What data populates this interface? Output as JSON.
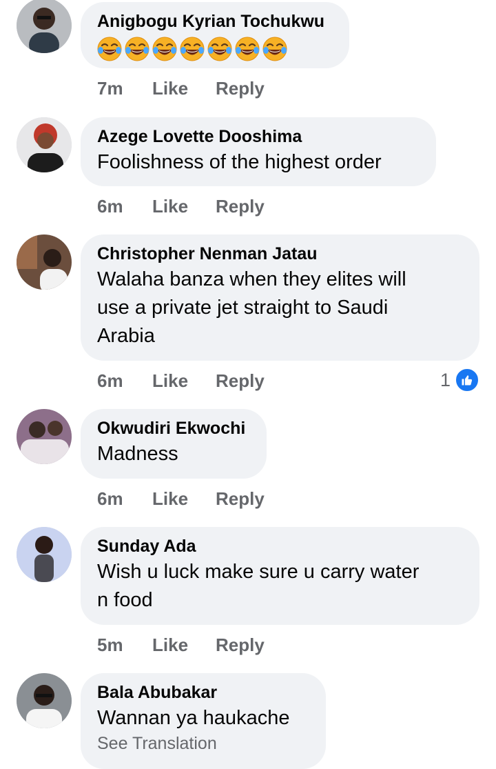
{
  "comments": [
    {
      "name": "Anigbogu Kyrian Tochukwu",
      "emoji": "😂😂😂😂😂😂😂",
      "emoji_count": 7,
      "time": "7m",
      "like": "Like",
      "reply": "Reply"
    },
    {
      "name": "Azege Lovette Dooshima",
      "text": "Foolishness of the highest order",
      "time": "6m",
      "like": "Like",
      "reply": "Reply"
    },
    {
      "name": "Christopher Nenman Jatau",
      "text_lines": [
        "Walaha banza when they elites will",
        "use a private jet straight to Saudi",
        "Arabia"
      ],
      "time": "6m",
      "like": "Like",
      "reply": "Reply",
      "reaction_count": "1"
    },
    {
      "name": "Okwudiri Ekwochi",
      "text": "Madness",
      "time": "6m",
      "like": "Like",
      "reply": "Reply"
    },
    {
      "name": "Sunday Ada",
      "text_lines": [
        "Wish u luck make sure u carry water",
        "n food"
      ],
      "time": "5m",
      "like": "Like",
      "reply": "Reply"
    },
    {
      "name": "Bala Abubakar",
      "text": "Wannan ya haukache",
      "see_translation": "See Translation"
    }
  ],
  "colors": {
    "bubble": "#f0f2f5",
    "meta_text": "#65676b",
    "like_badge": "#1877f2"
  },
  "icons": {
    "emoji": "face-with-tears-of-joy-icon",
    "reaction": "thumbs-up-icon"
  }
}
